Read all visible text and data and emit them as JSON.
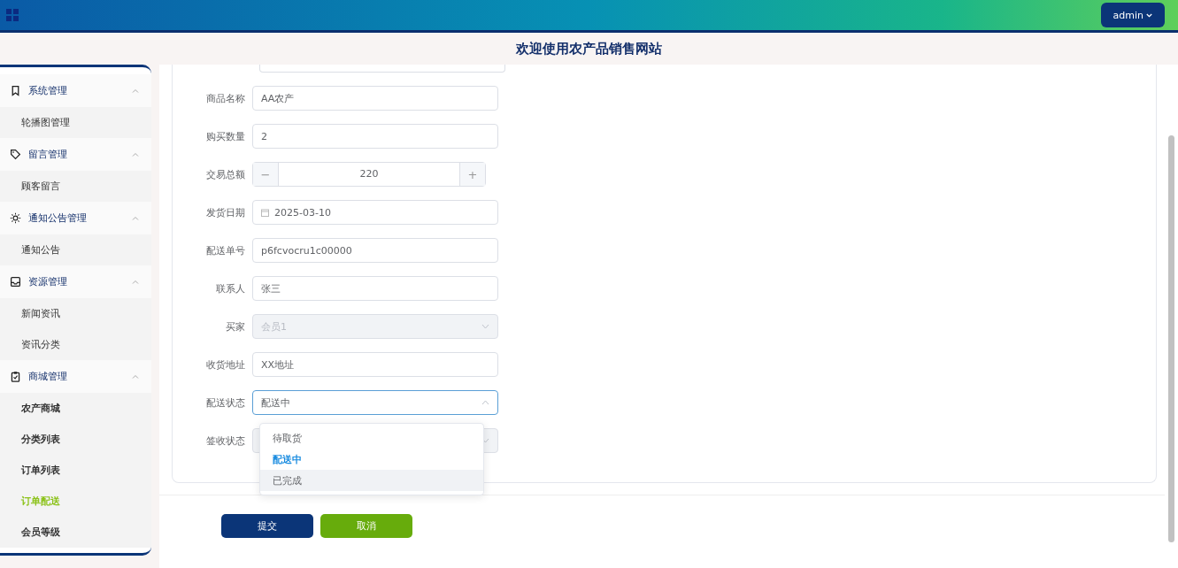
{
  "header": {
    "user": "admin"
  },
  "title": "欢迎使用农产品销售网站",
  "sidebar": {
    "groups": [
      {
        "label": "系统管理",
        "expanded": true,
        "children": [
          {
            "label": "轮播图管理",
            "selected": false
          }
        ]
      },
      {
        "label": "留言管理",
        "expanded": true,
        "children": [
          {
            "label": "顾客留言",
            "selected": false
          }
        ]
      },
      {
        "label": "通知公告管理",
        "expanded": true,
        "children": [
          {
            "label": "通知公告",
            "selected": false
          }
        ]
      },
      {
        "label": "资源管理",
        "expanded": true,
        "children": [
          {
            "label": "新闻资讯",
            "selected": false
          },
          {
            "label": "资讯分类",
            "selected": false
          }
        ]
      },
      {
        "label": "商城管理",
        "expanded": true,
        "bold_children": true,
        "children": [
          {
            "label": "农产商城",
            "selected": false
          },
          {
            "label": "分类列表",
            "selected": false
          },
          {
            "label": "订单列表",
            "selected": false
          },
          {
            "label": "订单配送",
            "selected": true
          },
          {
            "label": "会员等级",
            "selected": false
          }
        ]
      }
    ]
  },
  "form": {
    "fields": [
      {
        "label": "商品名称",
        "kind": "text",
        "value": "AA农产"
      },
      {
        "label": "购买数量",
        "kind": "text",
        "value": "2"
      },
      {
        "label": "交易总额",
        "kind": "stepper",
        "value": "220",
        "minus": "−",
        "plus": "+"
      },
      {
        "label": "发货日期",
        "kind": "date",
        "value": "2025-03-10"
      },
      {
        "label": "配送单号",
        "kind": "text",
        "value": "p6fcvocru1c00000"
      },
      {
        "label": "联系人",
        "kind": "text",
        "value": "张三"
      },
      {
        "label": "买家",
        "kind": "select",
        "value": "会员1",
        "disabled": true
      },
      {
        "label": "收货地址",
        "kind": "text",
        "value": "XX地址"
      },
      {
        "label": "配送状态",
        "kind": "select",
        "value": "配送中",
        "disabled": false,
        "open": true,
        "options": [
          {
            "label": "待取货",
            "selected": false,
            "hovered": false
          },
          {
            "label": "配送中",
            "selected": true,
            "hovered": false
          },
          {
            "label": "已完成",
            "selected": false,
            "hovered": true
          }
        ]
      },
      {
        "label": "签收状态",
        "kind": "select",
        "disabled": true
      }
    ]
  },
  "buttons": [
    {
      "label": "提交",
      "kind": "primary"
    },
    {
      "label": "取消",
      "kind": "cancel"
    }
  ]
}
